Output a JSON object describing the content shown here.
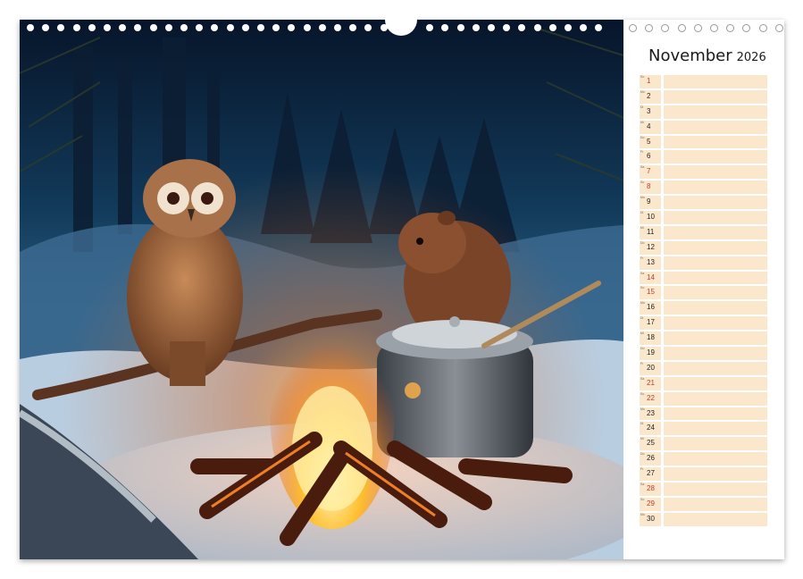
{
  "calendar": {
    "month": "November",
    "year": "2026",
    "days": [
      {
        "wd": "So",
        "num": "1",
        "holiday": true
      },
      {
        "wd": "Mo",
        "num": "2",
        "holiday": false
      },
      {
        "wd": "Di",
        "num": "3",
        "holiday": false
      },
      {
        "wd": "Mi",
        "num": "4",
        "holiday": false
      },
      {
        "wd": "Do",
        "num": "5",
        "holiday": false
      },
      {
        "wd": "Fr",
        "num": "6",
        "holiday": false
      },
      {
        "wd": "Sa",
        "num": "7",
        "holiday": true
      },
      {
        "wd": "So",
        "num": "8",
        "holiday": true
      },
      {
        "wd": "Mo",
        "num": "9",
        "holiday": false
      },
      {
        "wd": "Di",
        "num": "10",
        "holiday": false
      },
      {
        "wd": "Mi",
        "num": "11",
        "holiday": false
      },
      {
        "wd": "Do",
        "num": "12",
        "holiday": false
      },
      {
        "wd": "Fr",
        "num": "13",
        "holiday": false
      },
      {
        "wd": "Sa",
        "num": "14",
        "holiday": true
      },
      {
        "wd": "So",
        "num": "15",
        "holiday": true
      },
      {
        "wd": "Mo",
        "num": "16",
        "holiday": false
      },
      {
        "wd": "Di",
        "num": "17",
        "holiday": false
      },
      {
        "wd": "Mi",
        "num": "18",
        "holiday": false
      },
      {
        "wd": "Do",
        "num": "19",
        "holiday": false
      },
      {
        "wd": "Fr",
        "num": "20",
        "holiday": false
      },
      {
        "wd": "Sa",
        "num": "21",
        "holiday": true
      },
      {
        "wd": "So",
        "num": "22",
        "holiday": true
      },
      {
        "wd": "Mo",
        "num": "23",
        "holiday": false
      },
      {
        "wd": "Di",
        "num": "24",
        "holiday": false
      },
      {
        "wd": "Mi",
        "num": "25",
        "holiday": false
      },
      {
        "wd": "Do",
        "num": "26",
        "holiday": false
      },
      {
        "wd": "Fr",
        "num": "27",
        "holiday": false
      },
      {
        "wd": "Sa",
        "num": "28",
        "holiday": true
      },
      {
        "wd": "So",
        "num": "29",
        "holiday": true
      },
      {
        "wd": "Mo",
        "num": "30",
        "holiday": false
      }
    ]
  },
  "colors": {
    "day_cell": "#fbe8cc",
    "holiday_number": "#c0392b",
    "sky": "#0b1a2e",
    "fire": "#ff9a1f"
  }
}
